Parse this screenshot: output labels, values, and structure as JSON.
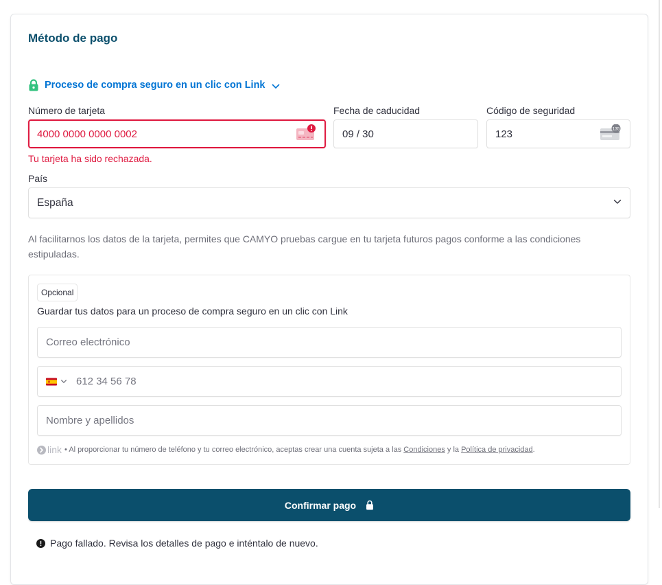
{
  "title": "Método de pago",
  "link_toggle": {
    "label": "Proceso de compra seguro en un clic con Link"
  },
  "card_number": {
    "label": "Número de tarjeta",
    "value": "4000 0000 0000 0002",
    "error": "Tu tarjeta ha sido rechazada."
  },
  "expiry": {
    "label": "Fecha de caducidad",
    "value": "09 / 30"
  },
  "cvc": {
    "label": "Código de seguridad",
    "value": "123",
    "card_icon_text": "135"
  },
  "country": {
    "label": "País",
    "value": "España"
  },
  "notice": "Al facilitarnos los datos de la tarjeta, permites que CAMYO pruebas cargue en tu tarjeta futuros pagos conforme a las condiciones estipuladas.",
  "link_save": {
    "badge": "Opcional",
    "text": "Guardar tus datos para un proceso de compra seguro en un clic con Link",
    "email_placeholder": "Correo electrónico",
    "phone_placeholder": "612 34 56 78",
    "name_placeholder": "Nombre y apellidos",
    "brand": "link",
    "legal_prefix": "• Al proporcionar tu número de teléfono y tu correo electrónico, aceptas crear una cuenta sujeta a las",
    "terms_link": "Condiciones",
    "legal_and": "y la",
    "privacy_link": "Política de privacidad",
    "legal_end": "."
  },
  "pay_button": {
    "label": "Confirmar pago"
  },
  "failure_message": "Pago fallado. Revisa los detalles de pago e inténtalo de nuevo.",
  "colors": {
    "accent": "#0b4f6c",
    "link_blue": "#0074d4",
    "error": "#df1b41",
    "lock_green": "#33c27f"
  },
  "icons": [
    "lock-icon",
    "chevron-down-icon",
    "card-error-icon",
    "cvc-card-icon",
    "spain-flag-icon",
    "link-logo-icon",
    "alert-icon"
  ]
}
